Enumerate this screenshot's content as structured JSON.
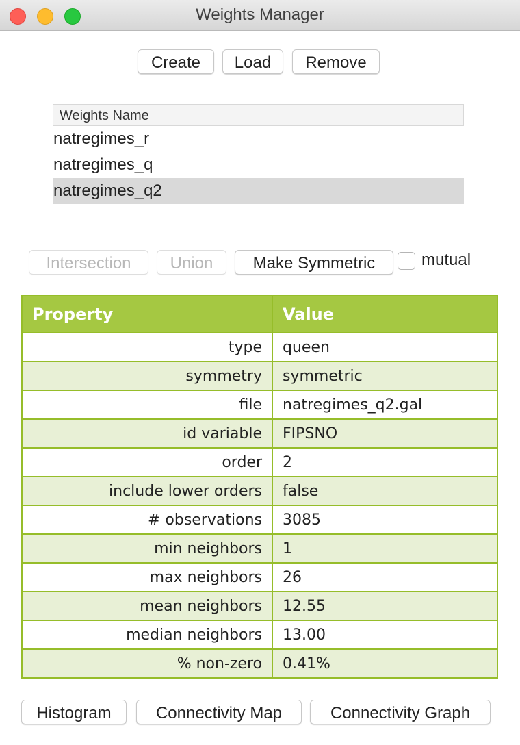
{
  "window": {
    "title": "Weights Manager",
    "colors": {
      "close": "#fe5f57",
      "minimize": "#febc2e",
      "maximize": "#28c840"
    }
  },
  "toolbar": {
    "create_label": "Create",
    "load_label": "Load",
    "remove_label": "Remove"
  },
  "weights_list": {
    "header": "Weights Name",
    "items": [
      {
        "name": "natregimes_r",
        "selected": false
      },
      {
        "name": "natregimes_q",
        "selected": false
      },
      {
        "name": "natregimes_q2",
        "selected": true
      }
    ]
  },
  "operations": {
    "intersection_label": "Intersection",
    "union_label": "Union",
    "make_symmetric_label": "Make Symmetric",
    "mutual_label": "mutual",
    "mutual_checked": false
  },
  "properties_table": {
    "header_color": "#a5c842",
    "alt_row_color": "#e8f0d6",
    "columns": [
      "Property",
      "Value"
    ],
    "rows": [
      {
        "property": "type",
        "value": "queen"
      },
      {
        "property": "symmetry",
        "value": "symmetric"
      },
      {
        "property": "file",
        "value": "natregimes_q2.gal"
      },
      {
        "property": "id variable",
        "value": "FIPSNO"
      },
      {
        "property": "order",
        "value": "2"
      },
      {
        "property": "include lower orders",
        "value": "false"
      },
      {
        "property": "# observations",
        "value": "3085"
      },
      {
        "property": "min neighbors",
        "value": "1"
      },
      {
        "property": "max neighbors",
        "value": "26"
      },
      {
        "property": "mean neighbors",
        "value": "12.55"
      },
      {
        "property": "median neighbors",
        "value": "13.00"
      },
      {
        "property": "% non-zero",
        "value": "0.41%"
      }
    ]
  },
  "bottom_buttons": {
    "histogram_label": "Histogram",
    "connectivity_map_label": "Connectivity Map",
    "connectivity_graph_label": "Connectivity Graph"
  }
}
